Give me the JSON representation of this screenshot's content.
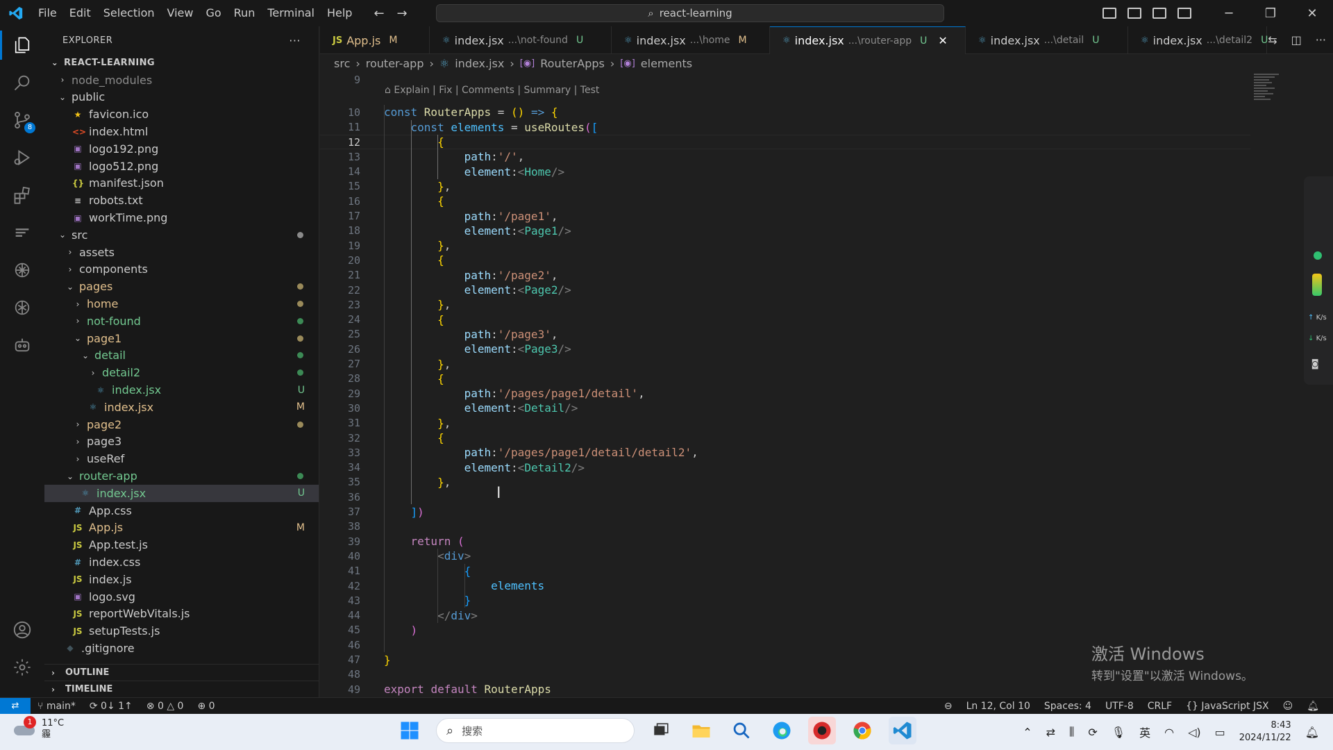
{
  "titlebar": {
    "menu": [
      "File",
      "Edit",
      "Selection",
      "View",
      "Go",
      "Run",
      "Terminal",
      "Help"
    ],
    "search_text": "react-learning"
  },
  "activity": {
    "scm_badge": "8"
  },
  "explorer": {
    "header": "EXPLORER",
    "more": "···",
    "root": "REACT-LEARNING",
    "items": [
      {
        "label": "node_modules",
        "depth": 1,
        "kind": "folder",
        "open": false,
        "color": "#8b8b8b"
      },
      {
        "label": "public",
        "depth": 1,
        "kind": "folder",
        "open": true,
        "color": "#cccccc"
      },
      {
        "label": "favicon.ico",
        "depth": 2,
        "kind": "star",
        "color": "#cccccc"
      },
      {
        "label": "index.html",
        "depth": 2,
        "kind": "html",
        "color": "#cccccc"
      },
      {
        "label": "logo192.png",
        "depth": 2,
        "kind": "img",
        "color": "#cccccc"
      },
      {
        "label": "logo512.png",
        "depth": 2,
        "kind": "img",
        "color": "#cccccc"
      },
      {
        "label": "manifest.json",
        "depth": 2,
        "kind": "json",
        "color": "#cccccc"
      },
      {
        "label": "robots.txt",
        "depth": 2,
        "kind": "txt",
        "color": "#cccccc"
      },
      {
        "label": "workTime.png",
        "depth": 2,
        "kind": "img",
        "color": "#cccccc"
      },
      {
        "label": "src",
        "depth": 1,
        "kind": "folder",
        "open": true,
        "color": "#cccccc",
        "dot": "#8a8a8a"
      },
      {
        "label": "assets",
        "depth": 2,
        "kind": "folder",
        "open": false,
        "color": "#cccccc"
      },
      {
        "label": "components",
        "depth": 2,
        "kind": "folder",
        "open": false,
        "color": "#cccccc"
      },
      {
        "label": "pages",
        "depth": 2,
        "kind": "folder",
        "open": true,
        "color": "#e2c08d",
        "dot": "#9a8a5a"
      },
      {
        "label": "home",
        "depth": 3,
        "kind": "folder",
        "open": false,
        "color": "#e2c08d",
        "dot": "#9a8a5a"
      },
      {
        "label": "not-found",
        "depth": 3,
        "kind": "folder",
        "open": false,
        "color": "#73c991",
        "dot": "#3c8a55"
      },
      {
        "label": "page1",
        "depth": 3,
        "kind": "folder",
        "open": true,
        "color": "#e2c08d",
        "dot": "#9a8a5a"
      },
      {
        "label": "detail",
        "depth": 4,
        "kind": "folder",
        "open": true,
        "color": "#73c991",
        "dot": "#3c8a55"
      },
      {
        "label": "detail2",
        "depth": 5,
        "kind": "folder",
        "open": false,
        "color": "#73c991",
        "dot": "#3c8a55"
      },
      {
        "label": "index.jsx",
        "depth": 5,
        "kind": "react",
        "color": "#73c991",
        "status": "U",
        "status_color": "#73c991"
      },
      {
        "label": "index.jsx",
        "depth": 4,
        "kind": "react",
        "color": "#e2c08d",
        "status": "M",
        "status_color": "#e2c08d"
      },
      {
        "label": "page2",
        "depth": 3,
        "kind": "folder",
        "open": false,
        "color": "#e2c08d",
        "dot": "#9a8a5a"
      },
      {
        "label": "page3",
        "depth": 3,
        "kind": "folder",
        "open": false,
        "color": "#cccccc"
      },
      {
        "label": "useRef",
        "depth": 3,
        "kind": "folder",
        "open": false,
        "color": "#cccccc"
      },
      {
        "label": "router-app",
        "depth": 2,
        "kind": "folder",
        "open": true,
        "color": "#73c991",
        "dot": "#3c8a55"
      },
      {
        "label": "index.jsx",
        "depth": 3,
        "kind": "react",
        "color": "#73c991",
        "status": "U",
        "status_color": "#73c991",
        "selected": true
      },
      {
        "label": "App.css",
        "depth": 2,
        "kind": "css",
        "color": "#cccccc"
      },
      {
        "label": "App.js",
        "depth": 2,
        "kind": "js",
        "color": "#e2c08d",
        "status": "M",
        "status_color": "#e2c08d"
      },
      {
        "label": "App.test.js",
        "depth": 2,
        "kind": "js",
        "color": "#cccccc"
      },
      {
        "label": "index.css",
        "depth": 2,
        "kind": "css",
        "color": "#cccccc"
      },
      {
        "label": "index.js",
        "depth": 2,
        "kind": "js",
        "color": "#cccccc"
      },
      {
        "label": "logo.svg",
        "depth": 2,
        "kind": "svg",
        "color": "#cccccc"
      },
      {
        "label": "reportWebVitals.js",
        "depth": 2,
        "kind": "js",
        "color": "#cccccc"
      },
      {
        "label": "setupTests.js",
        "depth": 2,
        "kind": "js",
        "color": "#cccccc"
      },
      {
        "label": ".gitignore",
        "depth": 1,
        "kind": "git",
        "color": "#cccccc"
      }
    ],
    "outline": "OUTLINE",
    "timeline": "TIMELINE"
  },
  "tabs": [
    {
      "icon": "JS",
      "name": "App.js",
      "desc": "",
      "status": "M",
      "status_color": "#e2c08d",
      "name_color": "#e2c08d"
    },
    {
      "icon": "⚛",
      "name": "index.jsx",
      "desc": "...\\not-found",
      "status": "U",
      "status_color": "#73c991",
      "name_color": "#cccccc"
    },
    {
      "icon": "⚛",
      "name": "index.jsx",
      "desc": "...\\home",
      "status": "M",
      "status_color": "#e2c08d",
      "name_color": "#cccccc"
    },
    {
      "icon": "⚛",
      "name": "index.jsx",
      "desc": "...\\router-app",
      "status": "U",
      "status_color": "#73c991",
      "name_color": "#ffffff",
      "active": true
    },
    {
      "icon": "⚛",
      "name": "index.jsx",
      "desc": "...\\detail",
      "status": "U",
      "status_color": "#73c991",
      "name_color": "#cccccc"
    },
    {
      "icon": "⚛",
      "name": "index.jsx",
      "desc": "...\\detail2",
      "status": "U",
      "status_color": "#73c991",
      "name_color": "#cccccc"
    }
  ],
  "breadcrumb": [
    "src",
    "router-app",
    "index.jsx",
    "RouterApps",
    "elements"
  ],
  "editor": {
    "codelens": "Explain | Fix | Comments | Summary | Test",
    "current_line": 12,
    "lines": [
      {
        "n": 9,
        "tokens": []
      },
      {
        "n": 10,
        "tokens": [
          [
            "kw",
            "const "
          ],
          [
            "fn",
            "RouterApps"
          ],
          [
            "punct",
            " = "
          ],
          [
            "br1",
            "()"
          ],
          [
            "punct",
            " "
          ],
          [
            "kw",
            "=>"
          ],
          [
            "punct",
            " "
          ],
          [
            "br1",
            "{"
          ]
        ]
      },
      {
        "n": 11,
        "tokens": [
          [
            "punct",
            "    "
          ],
          [
            "kw",
            "const "
          ],
          [
            "var",
            "elements"
          ],
          [
            "punct",
            " = "
          ],
          [
            "fn",
            "useRoutes"
          ],
          [
            "br2",
            "("
          ],
          [
            "br3",
            "["
          ]
        ]
      },
      {
        "n": 12,
        "tokens": [
          [
            "punct",
            "        "
          ],
          [
            "br1",
            "{"
          ]
        ]
      },
      {
        "n": 13,
        "tokens": [
          [
            "punct",
            "            "
          ],
          [
            "prop",
            "path"
          ],
          [
            "punct",
            ":"
          ],
          [
            "str",
            "'/'"
          ],
          [
            "punct",
            ","
          ]
        ]
      },
      {
        "n": 14,
        "tokens": [
          [
            "punct",
            "            "
          ],
          [
            "prop",
            "element"
          ],
          [
            "punct",
            ":"
          ],
          [
            "tagb",
            "<"
          ],
          [
            "tag",
            "Home"
          ],
          [
            "tagb",
            "/>"
          ]
        ]
      },
      {
        "n": 15,
        "tokens": [
          [
            "punct",
            "        "
          ],
          [
            "br1",
            "}"
          ],
          [
            "punct",
            ","
          ]
        ]
      },
      {
        "n": 16,
        "tokens": [
          [
            "punct",
            "        "
          ],
          [
            "br1",
            "{"
          ]
        ]
      },
      {
        "n": 17,
        "tokens": [
          [
            "punct",
            "            "
          ],
          [
            "prop",
            "path"
          ],
          [
            "punct",
            ":"
          ],
          [
            "str",
            "'/page1'"
          ],
          [
            "punct",
            ","
          ]
        ]
      },
      {
        "n": 18,
        "tokens": [
          [
            "punct",
            "            "
          ],
          [
            "prop",
            "element"
          ],
          [
            "punct",
            ":"
          ],
          [
            "tagb",
            "<"
          ],
          [
            "tag",
            "Page1"
          ],
          [
            "tagb",
            "/>"
          ]
        ]
      },
      {
        "n": 19,
        "tokens": [
          [
            "punct",
            "        "
          ],
          [
            "br1",
            "}"
          ],
          [
            "punct",
            ","
          ]
        ]
      },
      {
        "n": 20,
        "tokens": [
          [
            "punct",
            "        "
          ],
          [
            "br1",
            "{"
          ]
        ]
      },
      {
        "n": 21,
        "tokens": [
          [
            "punct",
            "            "
          ],
          [
            "prop",
            "path"
          ],
          [
            "punct",
            ":"
          ],
          [
            "str",
            "'/page2'"
          ],
          [
            "punct",
            ","
          ]
        ]
      },
      {
        "n": 22,
        "tokens": [
          [
            "punct",
            "            "
          ],
          [
            "prop",
            "element"
          ],
          [
            "punct",
            ":"
          ],
          [
            "tagb",
            "<"
          ],
          [
            "tag",
            "Page2"
          ],
          [
            "tagb",
            "/>"
          ]
        ]
      },
      {
        "n": 23,
        "tokens": [
          [
            "punct",
            "        "
          ],
          [
            "br1",
            "}"
          ],
          [
            "punct",
            ","
          ]
        ]
      },
      {
        "n": 24,
        "tokens": [
          [
            "punct",
            "        "
          ],
          [
            "br1",
            "{"
          ]
        ]
      },
      {
        "n": 25,
        "tokens": [
          [
            "punct",
            "            "
          ],
          [
            "prop",
            "path"
          ],
          [
            "punct",
            ":"
          ],
          [
            "str",
            "'/page3'"
          ],
          [
            "punct",
            ","
          ]
        ]
      },
      {
        "n": 26,
        "tokens": [
          [
            "punct",
            "            "
          ],
          [
            "prop",
            "element"
          ],
          [
            "punct",
            ":"
          ],
          [
            "tagb",
            "<"
          ],
          [
            "tag",
            "Page3"
          ],
          [
            "tagb",
            "/>"
          ]
        ]
      },
      {
        "n": 27,
        "tokens": [
          [
            "punct",
            "        "
          ],
          [
            "br1",
            "}"
          ],
          [
            "punct",
            ","
          ]
        ]
      },
      {
        "n": 28,
        "tokens": [
          [
            "punct",
            "        "
          ],
          [
            "br1",
            "{"
          ]
        ]
      },
      {
        "n": 29,
        "tokens": [
          [
            "punct",
            "            "
          ],
          [
            "prop",
            "path"
          ],
          [
            "punct",
            ":"
          ],
          [
            "str",
            "'/pages/page1/detail'"
          ],
          [
            "punct",
            ","
          ]
        ]
      },
      {
        "n": 30,
        "tokens": [
          [
            "punct",
            "            "
          ],
          [
            "prop",
            "element"
          ],
          [
            "punct",
            ":"
          ],
          [
            "tagb",
            "<"
          ],
          [
            "tag",
            "Detail"
          ],
          [
            "tagb",
            "/>"
          ]
        ]
      },
      {
        "n": 31,
        "tokens": [
          [
            "punct",
            "        "
          ],
          [
            "br1",
            "}"
          ],
          [
            "punct",
            ","
          ]
        ]
      },
      {
        "n": 32,
        "tokens": [
          [
            "punct",
            "        "
          ],
          [
            "br1",
            "{"
          ]
        ]
      },
      {
        "n": 33,
        "tokens": [
          [
            "punct",
            "            "
          ],
          [
            "prop",
            "path"
          ],
          [
            "punct",
            ":"
          ],
          [
            "str",
            "'/pages/page1/detail/detail2'"
          ],
          [
            "punct",
            ","
          ]
        ]
      },
      {
        "n": 34,
        "tokens": [
          [
            "punct",
            "            "
          ],
          [
            "prop",
            "element"
          ],
          [
            "punct",
            ":"
          ],
          [
            "tagb",
            "<"
          ],
          [
            "tag",
            "Detail2"
          ],
          [
            "tagb",
            "/>"
          ]
        ]
      },
      {
        "n": 35,
        "tokens": [
          [
            "punct",
            "        "
          ],
          [
            "br1",
            "}"
          ],
          [
            "punct",
            ","
          ]
        ]
      },
      {
        "n": 36,
        "tokens": []
      },
      {
        "n": 37,
        "tokens": [
          [
            "punct",
            "    "
          ],
          [
            "br3",
            "]"
          ],
          [
            "br2",
            ")"
          ]
        ]
      },
      {
        "n": 38,
        "tokens": []
      },
      {
        "n": 39,
        "tokens": [
          [
            "punct",
            "    "
          ],
          [
            "ctl",
            "return"
          ],
          [
            "punct",
            " "
          ],
          [
            "br2",
            "("
          ]
        ]
      },
      {
        "n": 40,
        "tokens": [
          [
            "punct",
            "        "
          ],
          [
            "tagb",
            "<"
          ],
          [
            "kw",
            "div"
          ],
          [
            "tagb",
            ">"
          ]
        ]
      },
      {
        "n": 41,
        "tokens": [
          [
            "punct",
            "            "
          ],
          [
            "br3",
            "{"
          ]
        ]
      },
      {
        "n": 42,
        "tokens": [
          [
            "punct",
            "                "
          ],
          [
            "var",
            "elements"
          ]
        ]
      },
      {
        "n": 43,
        "tokens": [
          [
            "punct",
            "            "
          ],
          [
            "br3",
            "}"
          ]
        ]
      },
      {
        "n": 44,
        "tokens": [
          [
            "punct",
            "        "
          ],
          [
            "tagb",
            "</"
          ],
          [
            "kw",
            "div"
          ],
          [
            "tagb",
            ">"
          ]
        ]
      },
      {
        "n": 45,
        "tokens": [
          [
            "punct",
            "    "
          ],
          [
            "br2",
            ")"
          ]
        ]
      },
      {
        "n": 46,
        "tokens": []
      },
      {
        "n": 47,
        "tokens": [
          [
            "br1",
            "}"
          ]
        ]
      },
      {
        "n": 48,
        "tokens": []
      },
      {
        "n": 49,
        "tokens": [
          [
            "ctl",
            "export"
          ],
          [
            "punct",
            " "
          ],
          [
            "ctl",
            "default"
          ],
          [
            "punct",
            " "
          ],
          [
            "fn",
            "RouterApps"
          ]
        ]
      }
    ]
  },
  "overlay": {
    "up_speed": "K/s",
    "down_speed": "K/s"
  },
  "activation": {
    "title": "激活 Windows",
    "subtitle": "转到\"设置\"以激活 Windows。"
  },
  "statusbar": {
    "branch": "main*",
    "sync": "0↓ 1↑",
    "errors": "0",
    "warnings": "0",
    "ports": "0",
    "position": "Ln 12, Col 10",
    "spaces": "Spaces: 4",
    "encoding": "UTF-8",
    "eol": "CRLF",
    "language": "JavaScript JSX"
  },
  "taskbar": {
    "weather_badge": "1",
    "temperature": "11°C",
    "weather_desc": "霾",
    "search_placeholder": "搜索",
    "ime": "英",
    "time": "8:43",
    "date": "2024/11/22"
  }
}
